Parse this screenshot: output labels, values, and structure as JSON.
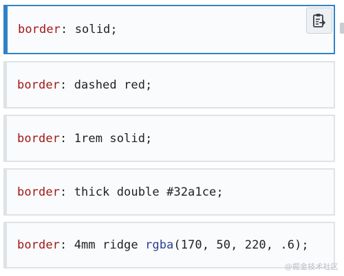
{
  "snippets": [
    {
      "prop": "border",
      "colon": ":",
      "value": " solid;"
    },
    {
      "prop": "border",
      "colon": ":",
      "value": " dashed red;"
    },
    {
      "prop": "border",
      "colon": ":",
      "value": " 1rem solid;"
    },
    {
      "prop": "border",
      "colon": ":",
      "value": " thick double #32a1ce;"
    },
    {
      "prop": "border",
      "colon": ":",
      "value_pre": " 4mm ridge ",
      "fn": "rgba",
      "value_post": "(170, 50, 220, .6);"
    }
  ],
  "copy_button": {
    "icon": "clipboard-copy-icon"
  },
  "watermark": {
    "text": "@掘金技术社区"
  },
  "colors": {
    "focus_border": "#2e82c6",
    "block_border": "#dde3e8",
    "property": "#a31515",
    "function": "#2b3d95"
  }
}
